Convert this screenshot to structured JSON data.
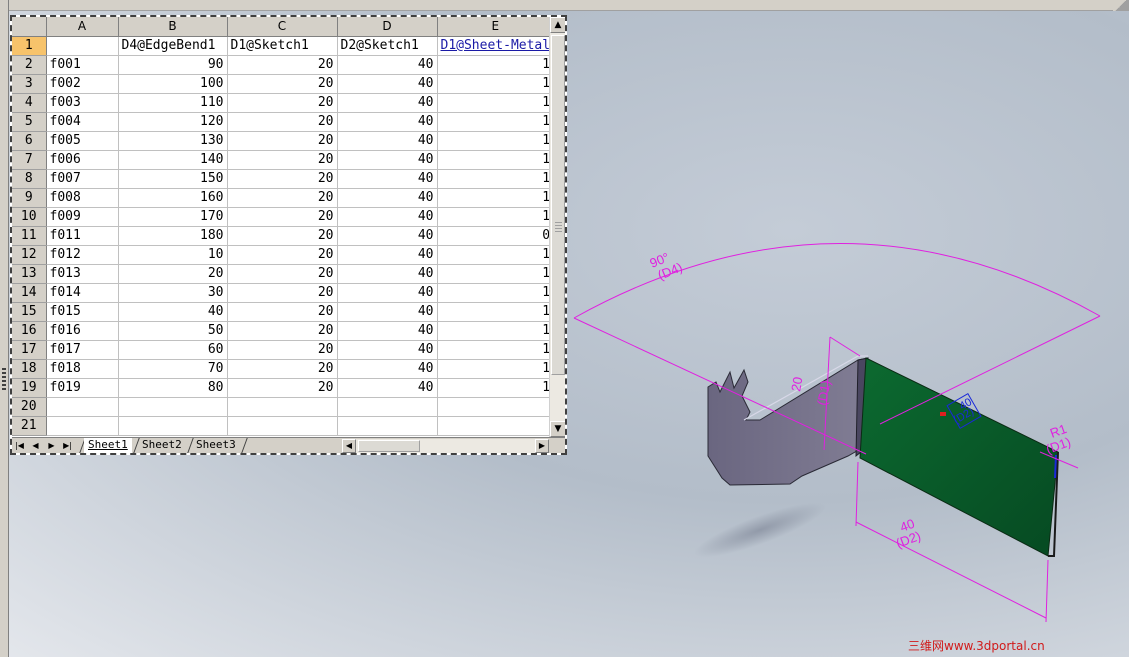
{
  "spreadsheet": {
    "columns": [
      "A",
      "B",
      "C",
      "D",
      "E"
    ],
    "rows": [
      {
        "row": "1",
        "cells": [
          "",
          "D4@EdgeBend1",
          "D1@Sketch1",
          "D2@Sketch1",
          "D1@Sheet-Metal"
        ]
      },
      {
        "row": "2",
        "cells": [
          "f001",
          "90",
          "20",
          "40",
          "1"
        ]
      },
      {
        "row": "3",
        "cells": [
          "f002",
          "100",
          "20",
          "40",
          "1"
        ]
      },
      {
        "row": "4",
        "cells": [
          "f003",
          "110",
          "20",
          "40",
          "1"
        ]
      },
      {
        "row": "5",
        "cells": [
          "f004",
          "120",
          "20",
          "40",
          "1"
        ]
      },
      {
        "row": "6",
        "cells": [
          "f005",
          "130",
          "20",
          "40",
          "1"
        ]
      },
      {
        "row": "7",
        "cells": [
          "f006",
          "140",
          "20",
          "40",
          "1"
        ]
      },
      {
        "row": "8",
        "cells": [
          "f007",
          "150",
          "20",
          "40",
          "1"
        ]
      },
      {
        "row": "9",
        "cells": [
          "f008",
          "160",
          "20",
          "40",
          "1"
        ]
      },
      {
        "row": "10",
        "cells": [
          "f009",
          "170",
          "20",
          "40",
          "1"
        ]
      },
      {
        "row": "11",
        "cells": [
          "f011",
          "180",
          "20",
          "40",
          "0"
        ]
      },
      {
        "row": "12",
        "cells": [
          "f012",
          "10",
          "20",
          "40",
          "1"
        ]
      },
      {
        "row": "13",
        "cells": [
          "f013",
          "20",
          "20",
          "40",
          "1"
        ]
      },
      {
        "row": "14",
        "cells": [
          "f014",
          "30",
          "20",
          "40",
          "1"
        ]
      },
      {
        "row": "15",
        "cells": [
          "f015",
          "40",
          "20",
          "40",
          "1"
        ]
      },
      {
        "row": "16",
        "cells": [
          "f016",
          "50",
          "20",
          "40",
          "1"
        ]
      },
      {
        "row": "17",
        "cells": [
          "f017",
          "60",
          "20",
          "40",
          "1"
        ]
      },
      {
        "row": "18",
        "cells": [
          "f018",
          "70",
          "20",
          "40",
          "1"
        ]
      },
      {
        "row": "19",
        "cells": [
          "f019",
          "80",
          "20",
          "40",
          "1"
        ]
      },
      {
        "row": "20",
        "cells": [
          "",
          "",
          "",
          "",
          ""
        ]
      },
      {
        "row": "21",
        "cells": [
          "",
          "",
          "",
          "",
          ""
        ]
      }
    ],
    "sheet_tabs": [
      "Sheet1",
      "Sheet2",
      "Sheet3"
    ],
    "active_tab": "Sheet1",
    "nav_buttons": [
      "first-sheet",
      "prev-sheet",
      "next-sheet",
      "last-sheet"
    ],
    "selected_row": "1"
  },
  "model_view": {
    "dimensions": {
      "angle": {
        "value": "90°",
        "name": "(D4)"
      },
      "height": {
        "value": "20",
        "name": "(D1)"
      },
      "length": {
        "value": "40",
        "name": "(D2)"
      },
      "radius": {
        "value": "R1",
        "name": "(D1)"
      },
      "sketch_small": {
        "value": "40",
        "name": "(D2)"
      }
    },
    "colors": {
      "dimension": "#e020e0",
      "face_green": "#0a5a2a",
      "face_gray": "#6e6a80",
      "sketch_blue": "#1a2ad8",
      "background": "#b7c0cc"
    }
  },
  "watermark": "三维网www.3dportal.cn"
}
